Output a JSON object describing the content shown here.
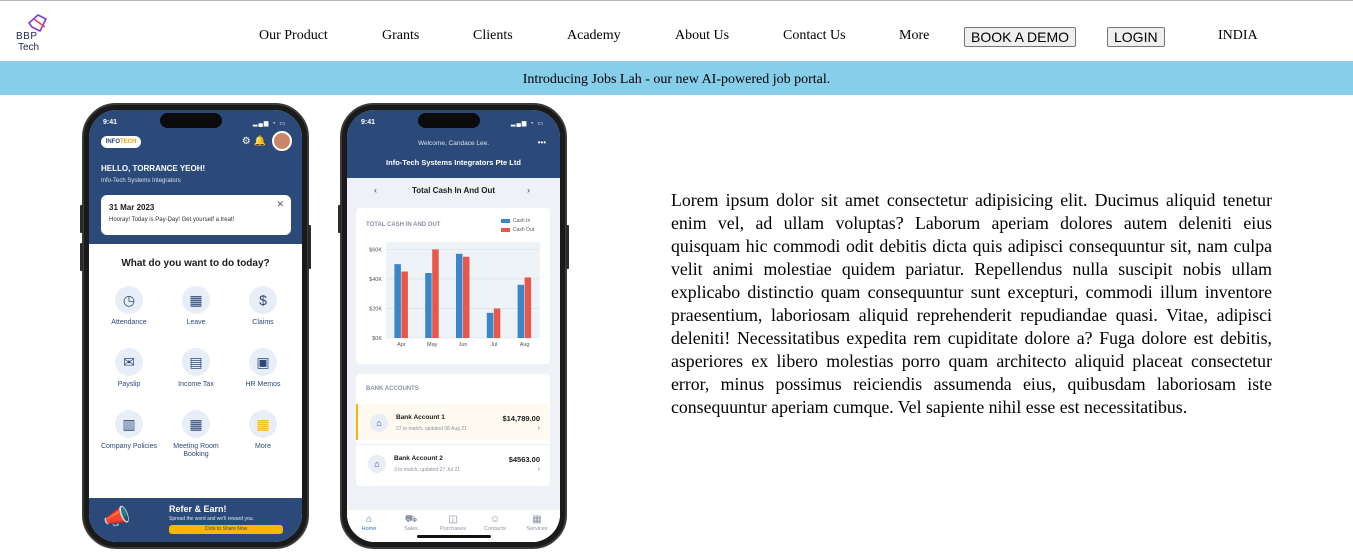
{
  "brand": {
    "logo_line1": "BBP",
    "logo_line2": "Tech",
    "logo_colors": [
      "#7b3fd8",
      "#e8455f",
      "#1b2a4a"
    ]
  },
  "nav": {
    "links": [
      "Our Product",
      "Grants",
      "Clients",
      "Academy",
      "About Us",
      "Contact Us",
      "More"
    ],
    "book_demo": "BOOK A DEMO",
    "login": "LOGIN",
    "region": "INDIA"
  },
  "banner": {
    "text": "Introducing Jobs Lah - our new AI-powered job portal.",
    "color": "#87ceeb"
  },
  "phone1": {
    "time": "9:41",
    "logo_a": "INFO",
    "logo_b": "TECH",
    "greeting": "HELLO, TORRANCE YEOH!",
    "company": "Info-Tech Systems Integrators",
    "card_date": "31 Mar 2023",
    "card_msg": "Hooray! Today is Pay-Day! Get yourself a treat!",
    "prompt": "What do you want to do today?",
    "tiles": [
      "Attendance",
      "Leave",
      "Claims",
      "Payslip",
      "Income Tax",
      "HR Memos",
      "Company Policies",
      "Meeting Room Booking",
      "More"
    ],
    "refer_title": "Refer & Earn!",
    "refer_sub": "Spread the word and we'll reward you.",
    "refer_cta": "Click to Share Now",
    "accent": "#2b4a7a"
  },
  "phone2": {
    "time": "9:41",
    "welcome": "Welcome, Candace Lee.",
    "company": "Info-Tech Systems Integrators Pte Ltd",
    "section": "Total Cash In And Out",
    "chart_title": "TOTAL CASH IN AND OUT",
    "bank_title": "BANK ACCOUNTS",
    "accounts": [
      {
        "name": "Bank Account 1",
        "amount": "$14,789.00",
        "sub": "27 to match, updated 08 Aug 21"
      },
      {
        "name": "Bank Account 2",
        "amount": "$4563.00",
        "sub": "3 to match, updated 27 Jul 21"
      }
    ],
    "tabs": [
      "Home",
      "Sales",
      "Purchases",
      "Contacts",
      "Services"
    ]
  },
  "chart_data": {
    "type": "bar",
    "title": "TOTAL CASH IN AND OUT",
    "categories": [
      "Apr",
      "May",
      "Jun",
      "Jul",
      "Aug"
    ],
    "series": [
      {
        "name": "Cash In",
        "color": "#3a86c8",
        "values": [
          50000,
          44000,
          57000,
          17000,
          36000
        ]
      },
      {
        "name": "Cash Out",
        "color": "#e8574a",
        "values": [
          45000,
          60000,
          55000,
          20000,
          41000
        ]
      }
    ],
    "yticks": [
      "$0K",
      "$20K",
      "$40K",
      "$60K"
    ],
    "ylim": [
      0,
      65000
    ],
    "legend_position": "top-right",
    "grid": true
  },
  "content": {
    "paragraph": "Lorem ipsum dolor sit amet consectetur adipisicing elit. Ducimus aliquid tenetur enim vel, ad ullam voluptas? Laborum aperiam dolores autem deleniti eius quisquam hic commodi odit debitis dicta quis adipisci consequuntur sit, nam culpa velit animi molestiae quidem pariatur. Repellendus nulla suscipit nobis ullam explicabo distinctio quam consequuntur sunt excepturi, commodi illum inventore praesentium, laboriosam aliquid reprehenderit repudiandae quasi. Vitae, adipisci deleniti! Necessitatibus expedita rem cupiditate dolore a? Fuga dolore est debitis, asperiores ex libero molestias porro quam architecto aliquid placeat consectetur error, minus possimus reiciendis assumenda eius, quibusdam laboriosam iste consequuntur aperiam cumque. Vel sapiente nihil esse est necessitatibus."
  }
}
